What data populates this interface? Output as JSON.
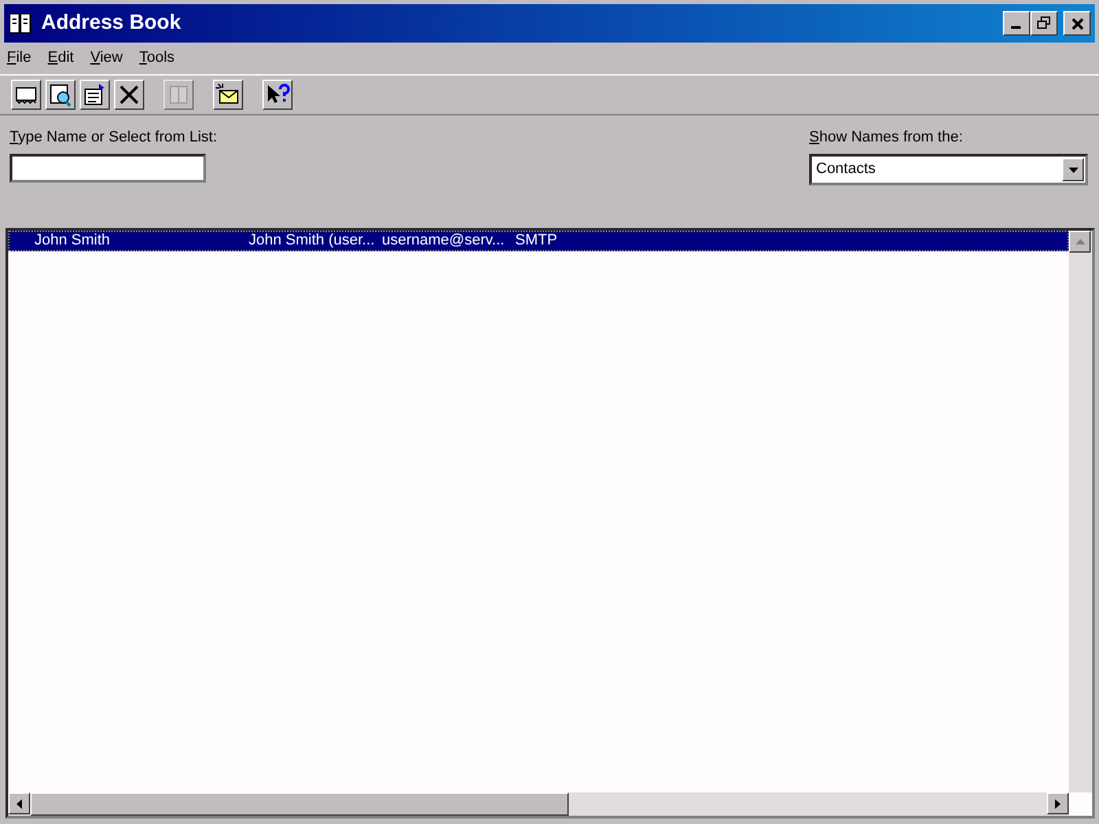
{
  "window": {
    "title": "Address Book"
  },
  "menu": [
    {
      "label": "File"
    },
    {
      "label": "Edit"
    },
    {
      "label": "View"
    },
    {
      "label": "Tools"
    }
  ],
  "toolbar": [
    {
      "kind": "new",
      "disabled": false
    },
    {
      "kind": "find",
      "disabled": false
    },
    {
      "kind": "properties",
      "disabled": false
    },
    {
      "kind": "delete",
      "disabled": false
    },
    {
      "kind": "book",
      "disabled": true
    },
    {
      "kind": "mail",
      "disabled": false
    },
    {
      "kind": "help",
      "disabled": false
    }
  ],
  "search": {
    "label": "Type Name or Select from List:"
  },
  "source": {
    "label": "Show Names from the:",
    "value": "Contacts"
  },
  "list": {
    "rows": [
      {
        "name": "John Smith",
        "display": "John Smith (user...",
        "email": "username@serv...",
        "type": "SMTP",
        "selected": true
      }
    ]
  }
}
